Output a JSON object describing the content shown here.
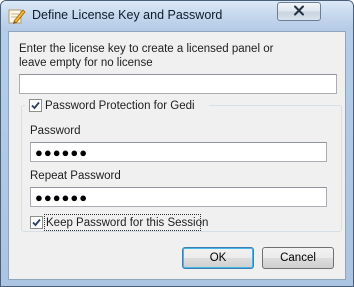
{
  "window": {
    "title": "Define License Key and Password"
  },
  "license": {
    "instructions_line1": "Enter the license key to create a licensed panel or",
    "instructions_line2": "leave empty for no license",
    "key_value": ""
  },
  "password_group": {
    "enabled_label": "Password Protection for Gedi",
    "enabled_checked": true,
    "password_label": "Password",
    "password_value": "●●●●●●",
    "repeat_label": "Repeat Password",
    "repeat_value": "●●●●●●",
    "keep_label": "Keep Password for this Session",
    "keep_checked": true
  },
  "buttons": {
    "ok_label": "OK",
    "cancel_label": "Cancel"
  },
  "icons": {
    "app": "pencil-paper-icon",
    "close": "close-icon"
  }
}
